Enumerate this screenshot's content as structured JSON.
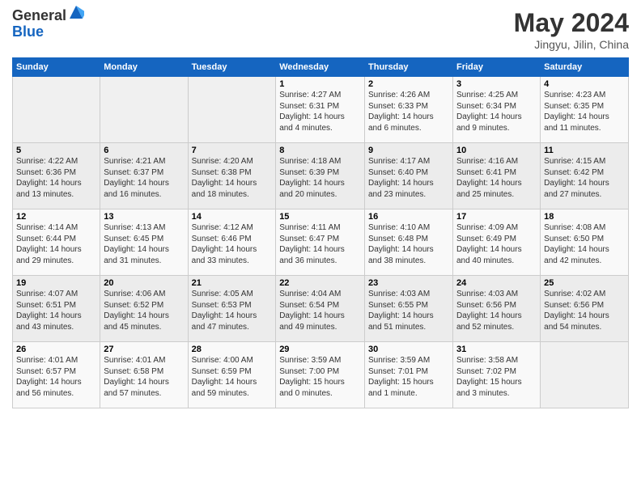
{
  "logo": {
    "general": "General",
    "blue": "Blue"
  },
  "title": "May 2024",
  "location": "Jingyu, Jilin, China",
  "days_of_week": [
    "Sunday",
    "Monday",
    "Tuesday",
    "Wednesday",
    "Thursday",
    "Friday",
    "Saturday"
  ],
  "weeks": [
    [
      {
        "day": "",
        "content": ""
      },
      {
        "day": "",
        "content": ""
      },
      {
        "day": "",
        "content": ""
      },
      {
        "day": "1",
        "content": "Sunrise: 4:27 AM\nSunset: 6:31 PM\nDaylight: 14 hours\nand 4 minutes."
      },
      {
        "day": "2",
        "content": "Sunrise: 4:26 AM\nSunset: 6:33 PM\nDaylight: 14 hours\nand 6 minutes."
      },
      {
        "day": "3",
        "content": "Sunrise: 4:25 AM\nSunset: 6:34 PM\nDaylight: 14 hours\nand 9 minutes."
      },
      {
        "day": "4",
        "content": "Sunrise: 4:23 AM\nSunset: 6:35 PM\nDaylight: 14 hours\nand 11 minutes."
      }
    ],
    [
      {
        "day": "5",
        "content": "Sunrise: 4:22 AM\nSunset: 6:36 PM\nDaylight: 14 hours\nand 13 minutes."
      },
      {
        "day": "6",
        "content": "Sunrise: 4:21 AM\nSunset: 6:37 PM\nDaylight: 14 hours\nand 16 minutes."
      },
      {
        "day": "7",
        "content": "Sunrise: 4:20 AM\nSunset: 6:38 PM\nDaylight: 14 hours\nand 18 minutes."
      },
      {
        "day": "8",
        "content": "Sunrise: 4:18 AM\nSunset: 6:39 PM\nDaylight: 14 hours\nand 20 minutes."
      },
      {
        "day": "9",
        "content": "Sunrise: 4:17 AM\nSunset: 6:40 PM\nDaylight: 14 hours\nand 23 minutes."
      },
      {
        "day": "10",
        "content": "Sunrise: 4:16 AM\nSunset: 6:41 PM\nDaylight: 14 hours\nand 25 minutes."
      },
      {
        "day": "11",
        "content": "Sunrise: 4:15 AM\nSunset: 6:42 PM\nDaylight: 14 hours\nand 27 minutes."
      }
    ],
    [
      {
        "day": "12",
        "content": "Sunrise: 4:14 AM\nSunset: 6:44 PM\nDaylight: 14 hours\nand 29 minutes."
      },
      {
        "day": "13",
        "content": "Sunrise: 4:13 AM\nSunset: 6:45 PM\nDaylight: 14 hours\nand 31 minutes."
      },
      {
        "day": "14",
        "content": "Sunrise: 4:12 AM\nSunset: 6:46 PM\nDaylight: 14 hours\nand 33 minutes."
      },
      {
        "day": "15",
        "content": "Sunrise: 4:11 AM\nSunset: 6:47 PM\nDaylight: 14 hours\nand 36 minutes."
      },
      {
        "day": "16",
        "content": "Sunrise: 4:10 AM\nSunset: 6:48 PM\nDaylight: 14 hours\nand 38 minutes."
      },
      {
        "day": "17",
        "content": "Sunrise: 4:09 AM\nSunset: 6:49 PM\nDaylight: 14 hours\nand 40 minutes."
      },
      {
        "day": "18",
        "content": "Sunrise: 4:08 AM\nSunset: 6:50 PM\nDaylight: 14 hours\nand 42 minutes."
      }
    ],
    [
      {
        "day": "19",
        "content": "Sunrise: 4:07 AM\nSunset: 6:51 PM\nDaylight: 14 hours\nand 43 minutes."
      },
      {
        "day": "20",
        "content": "Sunrise: 4:06 AM\nSunset: 6:52 PM\nDaylight: 14 hours\nand 45 minutes."
      },
      {
        "day": "21",
        "content": "Sunrise: 4:05 AM\nSunset: 6:53 PM\nDaylight: 14 hours\nand 47 minutes."
      },
      {
        "day": "22",
        "content": "Sunrise: 4:04 AM\nSunset: 6:54 PM\nDaylight: 14 hours\nand 49 minutes."
      },
      {
        "day": "23",
        "content": "Sunrise: 4:03 AM\nSunset: 6:55 PM\nDaylight: 14 hours\nand 51 minutes."
      },
      {
        "day": "24",
        "content": "Sunrise: 4:03 AM\nSunset: 6:56 PM\nDaylight: 14 hours\nand 52 minutes."
      },
      {
        "day": "25",
        "content": "Sunrise: 4:02 AM\nSunset: 6:56 PM\nDaylight: 14 hours\nand 54 minutes."
      }
    ],
    [
      {
        "day": "26",
        "content": "Sunrise: 4:01 AM\nSunset: 6:57 PM\nDaylight: 14 hours\nand 56 minutes."
      },
      {
        "day": "27",
        "content": "Sunrise: 4:01 AM\nSunset: 6:58 PM\nDaylight: 14 hours\nand 57 minutes."
      },
      {
        "day": "28",
        "content": "Sunrise: 4:00 AM\nSunset: 6:59 PM\nDaylight: 14 hours\nand 59 minutes."
      },
      {
        "day": "29",
        "content": "Sunrise: 3:59 AM\nSunset: 7:00 PM\nDaylight: 15 hours\nand 0 minutes."
      },
      {
        "day": "30",
        "content": "Sunrise: 3:59 AM\nSunset: 7:01 PM\nDaylight: 15 hours\nand 1 minute."
      },
      {
        "day": "31",
        "content": "Sunrise: 3:58 AM\nSunset: 7:02 PM\nDaylight: 15 hours\nand 3 minutes."
      },
      {
        "day": "",
        "content": ""
      }
    ]
  ]
}
